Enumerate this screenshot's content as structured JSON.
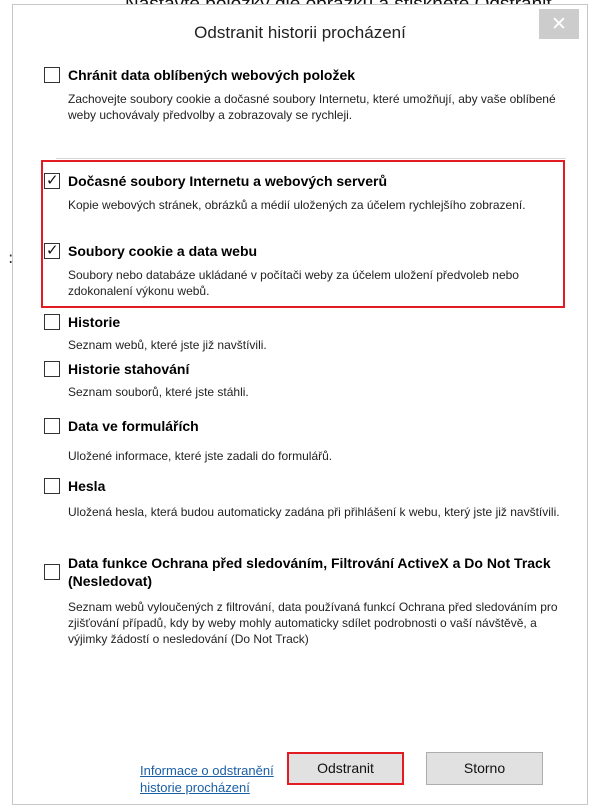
{
  "background_text": "Nastavte položky dle obrázku a stiskněte Odstranit",
  "background_colon": ":",
  "dialog": {
    "title": "Odstranit historii procházení",
    "close_glyph": "✕"
  },
  "options": [
    {
      "title": "Chránit data oblíbených webových položek",
      "description": "Zachovejte soubory cookie a dočasné soubory Internetu, které umožňují, aby vaše oblíbené weby uchovávaly předvolby a zobrazovaly se rychleji.",
      "checked": false
    },
    {
      "title": "Dočasné soubory Internetu a webových serverů",
      "description": "Kopie webových stránek, obrázků a médií uložených za účelem rychlejšího zobrazení.",
      "checked": true
    },
    {
      "title": "Soubory cookie a data webu",
      "description": "Soubory nebo databáze ukládané v počítači weby za účelem uložení předvoleb nebo zdokonalení výkonu webů.",
      "checked": true
    },
    {
      "title": "Historie",
      "description": "Seznam webů, které jste již navštívili.",
      "checked": false
    },
    {
      "title": "Historie stahování",
      "description": "Seznam souborů, které jste stáhli.",
      "checked": false
    },
    {
      "title": "Data ve formulářích",
      "description": "Uložené informace, které jste zadali do formulářů.",
      "checked": false
    },
    {
      "title": "Hesla",
      "description": "Uložená hesla, která budou automaticky zadána při přihlášení k webu, který jste již navštívili.",
      "checked": false
    },
    {
      "title": "Data funkce Ochrana před sledováním, Filtrování ActiveX a Do Not Track (Nesledovat)",
      "description": "Seznam webů vyloučených z filtrování, data používaná funkcí Ochrana před sledováním pro zjišťování případů, kdy by weby mohly automaticky sdílet podrobnosti o vaší návštěvě, a výjimky žádostí o nesledování (Do Not Track)",
      "checked": false
    }
  ],
  "check_glyph": "✓",
  "footer": {
    "help_link": "Informace o odstranění historie procházení",
    "delete_button": "Odstranit",
    "cancel_button": "Storno"
  },
  "colors": {
    "highlight": "#e31b23",
    "link": "#1b5fa5"
  }
}
